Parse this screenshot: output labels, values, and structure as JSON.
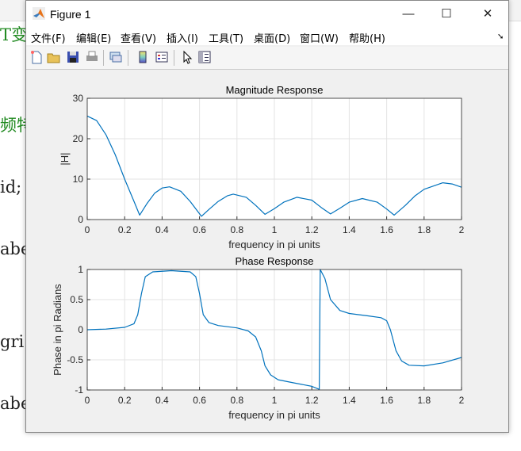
{
  "background_editor": {
    "lines": [
      "T变",
      "频特",
      "id;",
      "abe",
      "gri",
      "abe"
    ]
  },
  "window": {
    "title": "Figure 1",
    "buttons": {
      "minimize": "—",
      "maximize": "☐",
      "close": "✕"
    }
  },
  "menu": [
    "文件(F)",
    "编辑(E)",
    "查看(V)",
    "插入(I)",
    "工具(T)",
    "桌面(D)",
    "窗口(W)",
    "帮助(H)"
  ],
  "toolbar": [
    "new-file",
    "open-file",
    "save",
    "print",
    "link-plot",
    "colorbar",
    "legend",
    "select-pointer",
    "property-inspector"
  ],
  "colors": {
    "line": "#0072bd",
    "grid": "#e3e3e3"
  },
  "chart_data": [
    {
      "type": "line",
      "title": "Magnitude Response",
      "xlabel": "frequency in pi units",
      "ylabel": "|H|",
      "xlim": [
        0,
        2
      ],
      "ylim": [
        0,
        30
      ],
      "grid": true,
      "xticks": [
        "0",
        "0.2",
        "0.4",
        "0.6",
        "0.8",
        "1",
        "1.2",
        "1.4",
        "1.6",
        "1.8",
        "2"
      ],
      "yticks": [
        "0",
        "10",
        "20",
        "30"
      ],
      "x": [
        0,
        0.05,
        0.1,
        0.15,
        0.2,
        0.25,
        0.28,
        0.32,
        0.36,
        0.4,
        0.44,
        0.5,
        0.55,
        0.61,
        0.65,
        0.7,
        0.75,
        0.78,
        0.85,
        0.9,
        0.95,
        1.0,
        1.05,
        1.12,
        1.2,
        1.25,
        1.3,
        1.35,
        1.4,
        1.47,
        1.55,
        1.6,
        1.64,
        1.7,
        1.75,
        1.8,
        1.9,
        1.95,
        2.0
      ],
      "y": [
        25.6,
        24.5,
        21,
        16,
        10,
        4.5,
        1.1,
        4,
        6.5,
        7.8,
        8.1,
        7,
        4.5,
        0.8,
        2.5,
        4.5,
        5.9,
        6.3,
        5.5,
        3.5,
        1.3,
        2.7,
        4.3,
        5.5,
        4.8,
        3,
        1.4,
        2.8,
        4.3,
        5.2,
        4.3,
        2.6,
        1.1,
        3.5,
        5.8,
        7.5,
        9.1,
        8.8,
        8.0
      ]
    },
    {
      "type": "line",
      "title": "Phase Response",
      "xlabel": "frequency in pi units",
      "ylabel": "Phase in pi Radians",
      "xlim": [
        0,
        2
      ],
      "ylim": [
        -1,
        1
      ],
      "grid": true,
      "xticks": [
        "0",
        "0.2",
        "0.4",
        "0.6",
        "0.8",
        "1",
        "1.2",
        "1.4",
        "1.6",
        "1.8",
        "2"
      ],
      "yticks": [
        "-1",
        "-0.5",
        "0",
        "0.5",
        "1"
      ],
      "x": [
        0,
        0.1,
        0.2,
        0.25,
        0.27,
        0.29,
        0.31,
        0.35,
        0.45,
        0.55,
        0.58,
        0.6,
        0.62,
        0.65,
        0.7,
        0.8,
        0.86,
        0.9,
        0.93,
        0.95,
        0.98,
        1.02,
        1.1,
        1.2,
        1.24,
        1.245,
        1.27,
        1.3,
        1.35,
        1.4,
        1.5,
        1.57,
        1.6,
        1.62,
        1.65,
        1.68,
        1.72,
        1.8,
        1.9,
        2.0
      ],
      "y": [
        0,
        0.01,
        0.04,
        0.1,
        0.25,
        0.6,
        0.88,
        0.96,
        0.98,
        0.96,
        0.88,
        0.6,
        0.25,
        0.12,
        0.07,
        0.03,
        -0.02,
        -0.12,
        -0.35,
        -0.6,
        -0.75,
        -0.83,
        -0.88,
        -0.94,
        -0.99,
        1.0,
        0.85,
        0.5,
        0.32,
        0.27,
        0.23,
        0.2,
        0.15,
        0.0,
        -0.35,
        -0.52,
        -0.59,
        -0.6,
        -0.55,
        -0.46
      ]
    }
  ]
}
